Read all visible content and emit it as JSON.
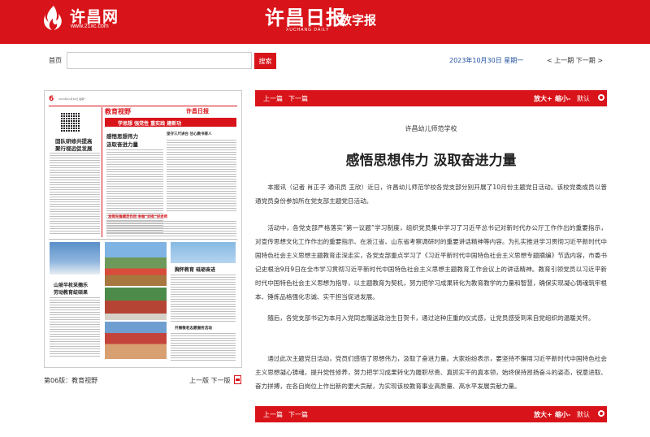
{
  "header": {
    "site_logo_name": "许昌网",
    "site_logo_url": "www.21xc.com",
    "paper_name": "许昌日报",
    "paper_english": "XUCHANG DAILY",
    "digital_label": "数字报"
  },
  "toolbar": {
    "home_label": "首页",
    "search_placeholder": "",
    "search_button": "搜索",
    "date": "2023年10月30日 星期一",
    "date_nav": "< 上一期  下一期 >"
  },
  "edition": {
    "name": "第06版：教育视野",
    "nav": "上一版  下一版"
  },
  "newspaper": {
    "page_number": "6",
    "meta": "2023年10月30日 星期一",
    "section_title": "教育视野",
    "paper_logo": "许昌日报",
    "banner": "学思想 强党性 重实践 建新功",
    "headlines": [
      "固队研修共提高",
      "聚行视远促发展",
      "感悟思想伟力",
      "汲取奋进力量",
      "坚守三尺讲台 甘心教书育人",
      "发挥先锋模范作用 争做“四有”好老师",
      "山坡半枚采摘乐",
      "劳动教育绽硕果",
      "胸怀教育 砥砺奋进",
      "开展敬老志愿服务活动"
    ]
  },
  "article_bar": {
    "prev": "上一篇",
    "next": "下一篇",
    "zoom_in": "放大+",
    "zoom_out": "缩小-",
    "zoom_reset": "默认"
  },
  "article": {
    "source": "许昌幼儿师范学校",
    "title": "感悟思想伟力 汲取奋进力量",
    "paragraphs": [
      "本报讯（记者 肖正子 通讯员 王欣）近日，许昌幼儿师范学校各党支部分别开展了10月份主题党日活动。该校党委成员以普通党员身份参加所在党支部主题党日活动。",
      "活动中，各党支部严格落实“第一议题”学习制度，组织党员集中学习了习近平总书记对新时代办公厅工作作出的重要指示，对宣传思想文化工作作出的重要指示、在浙江省、山东省考察调研时的重要讲话精神等内容。为扎实推进学习贯彻习近平新时代中国特色社会主义思想主题教育走深走实，各党支部重点学习了《习近平新时代中国特色社会主义思想专题摘编》节选内容，市委书记史根治9月9日在全市学习贯彻习近平新时代中国特色社会主义思想主题教育工作会议上的讲话精神。教育引领党员以习近平新时代中国特色社会主义思想为指导，以主题教育为契机，努力把学习成果转化为教育教学的力量和智慧，确保实现凝心铸魂筑牢根本、锤炼品格强化忠诚、实干担当促进发展。",
      "随后，各党支部书记为本月入党同志赠送政治生日贺卡，通过这种庄重的仪式感，让党员感受到来自党组织的温暖关怀。",
      "通过此次主题党日活动，党员们感悟了思想伟力，汲取了奋进力量。大家纷纷表示，要坚持不懈用习近平新时代中国特色社会主义思想凝心铸魂，提升党性修养，努力把学习成果转化为履职尽责、真抓实干的真本领，始终保持昂扬奋斗的姿态，锐意进取、奋力拼搏，在各自岗位上作出新的更大贡献，为实现该校教育事业高质量、高水平发展贡献力量。"
    ]
  },
  "colors": {
    "brand_red": "#d8141a",
    "date_blue": "#1f4e9c"
  }
}
